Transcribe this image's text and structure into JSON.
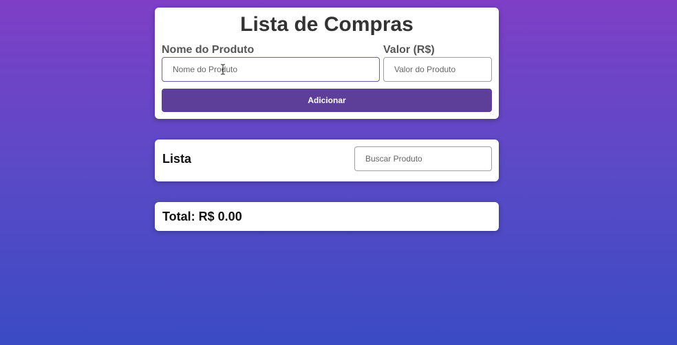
{
  "form": {
    "title": "Lista de Compras",
    "name_label": "Nome do Produto",
    "name_placeholder": "Nome do Produto",
    "name_value": "",
    "price_label": "Valor (R$)",
    "price_placeholder": "Valor do Produto",
    "price_value": "",
    "add_button_label": "Adicionar"
  },
  "list": {
    "heading": "Lista",
    "search_placeholder": "Buscar Produto",
    "search_value": "",
    "items": []
  },
  "total": {
    "text": "Total: R$ 0.00"
  },
  "colors": {
    "accent": "#5d3f9a",
    "background_top": "#7e3fc6",
    "background_bottom": "#3a4bc4"
  }
}
